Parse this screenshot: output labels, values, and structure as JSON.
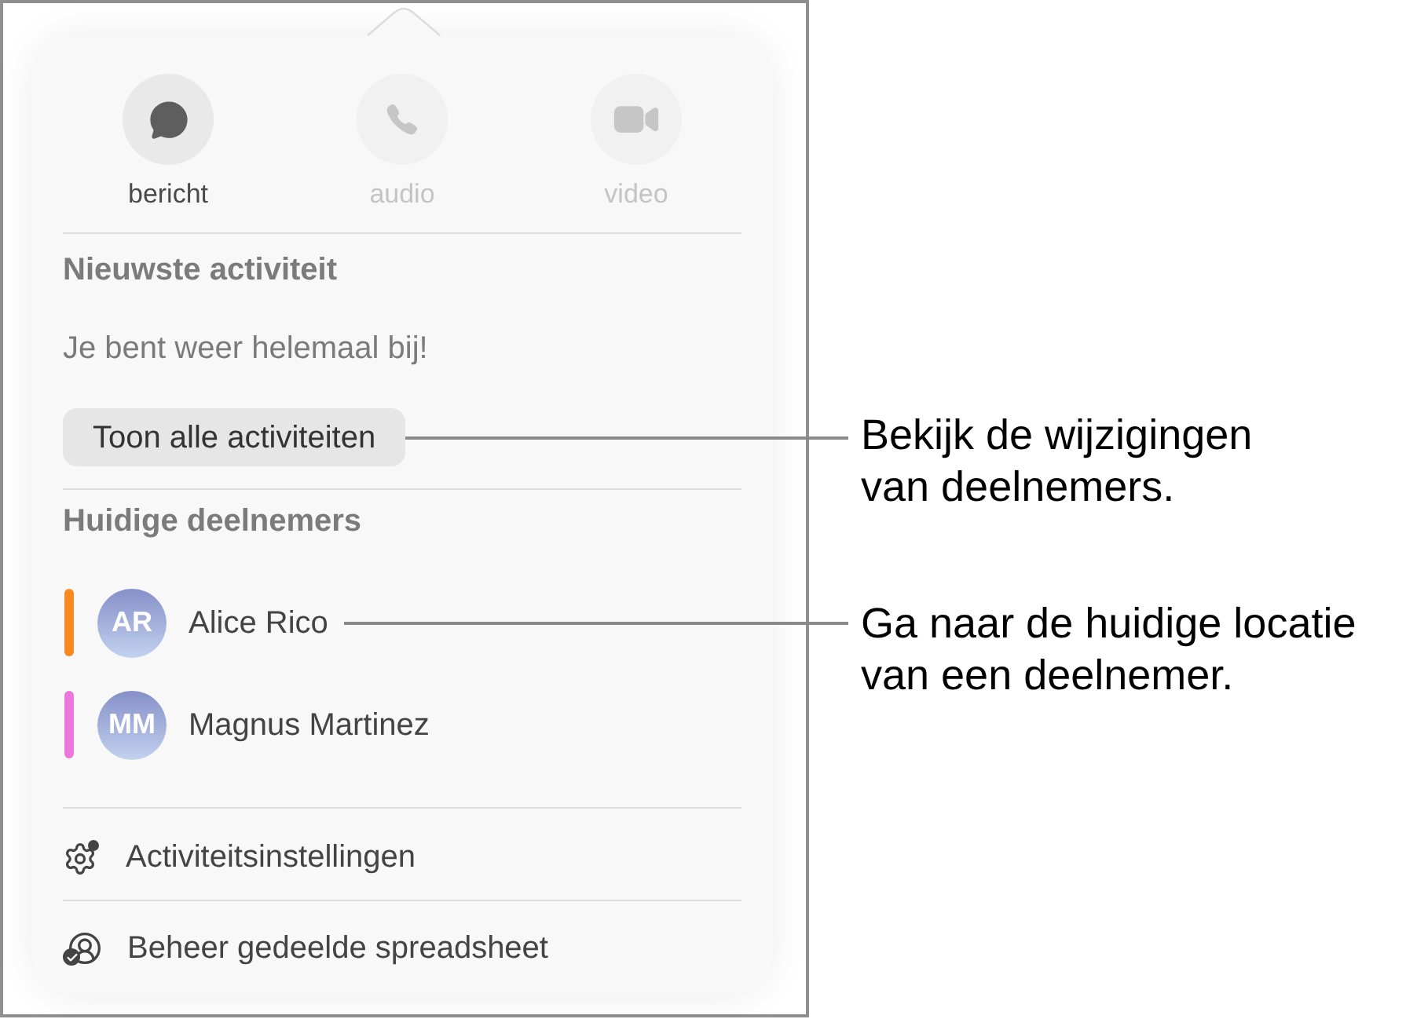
{
  "actions": [
    {
      "kind": "message",
      "label": "bericht",
      "disabled": false
    },
    {
      "kind": "phone",
      "label": "audio",
      "disabled": true
    },
    {
      "kind": "video",
      "label": "video",
      "disabled": true
    }
  ],
  "recent_activity": {
    "heading": "Nieuwste activiteit",
    "status": "Je bent weer helemaal bij!",
    "button": "Toon alle activiteiten"
  },
  "participants": {
    "heading": "Huidige deelnemers",
    "items": [
      {
        "initials": "AR",
        "name": "Alice Rico",
        "color": "#f8891f"
      },
      {
        "initials": "MM",
        "name": "Magnus Martinez",
        "color": "#ec76dc"
      }
    ]
  },
  "menu_items": [
    {
      "kind": "settings",
      "label": "Activiteitsinstellingen"
    },
    {
      "kind": "manage",
      "label": "Beheer gedeelde spreadsheet"
    }
  ],
  "callouts": [
    {
      "text": "Bekijk de wijzigingen\nvan deelnemers."
    },
    {
      "text": "Ga naar de huidige locatie\nvan een deelnemer."
    }
  ]
}
